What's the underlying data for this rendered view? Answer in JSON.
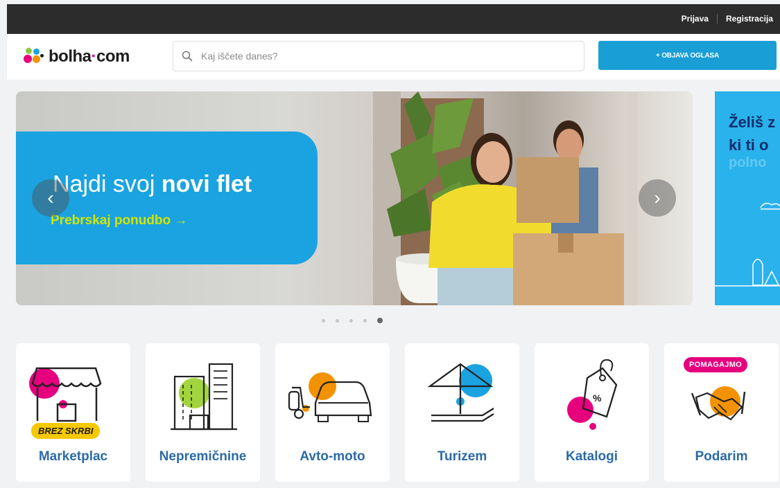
{
  "topbar": {
    "login": "Prijava",
    "register": "Registracija"
  },
  "header": {
    "logo_main": "bolha",
    "logo_dot": "·",
    "logo_tld": "com",
    "search_placeholder": "Kaj iščete danes?",
    "post_button": "+ OBJAVA OGLASA"
  },
  "banner": {
    "headline_regular": "Najdi svoj ",
    "headline_bold": "novi flet",
    "cta": "Prebrskaj ponudbo →",
    "active_slide": 5,
    "slide_count": 5
  },
  "next_banner": {
    "line1": "Želiš z",
    "line2": "ki ti o",
    "line3": "polno"
  },
  "categories": [
    {
      "label": "Marketplac",
      "badge": "BREZ SKRBI",
      "icon": "shop-icon"
    },
    {
      "label": "Nepremičnine",
      "icon": "building-icon"
    },
    {
      "label": "Avto-moto",
      "icon": "car-scooter-icon"
    },
    {
      "label": "Turizem",
      "icon": "beach-umbrella-icon"
    },
    {
      "label": "Katalogi",
      "icon": "price-tag-icon"
    },
    {
      "label": "Podarim",
      "badge": "POMAGAJMO",
      "icon": "handshake-icon"
    }
  ],
  "colors": {
    "accent": "#1a9ed6",
    "topbar": "#2c2c2c",
    "pink": "#e6007e",
    "orange": "#f39200",
    "blue": "#1aa3e0",
    "yellow_green": "#d4e500",
    "category_text": "#2b6aa8"
  }
}
